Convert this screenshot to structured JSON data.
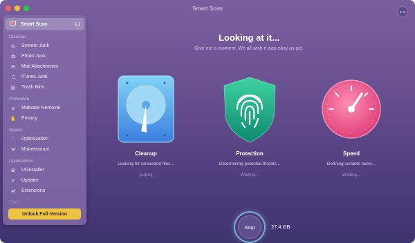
{
  "window": {
    "title": "Smart Scan"
  },
  "sidebar": {
    "active_item": {
      "label": "Smart Scan",
      "icon": "smart-scan-icon"
    },
    "sections": [
      {
        "title": "Cleanup",
        "items": [
          {
            "label": "System Junk",
            "icon": "system-junk-icon"
          },
          {
            "label": "Photo Junk",
            "icon": "photo-junk-icon"
          },
          {
            "label": "Mail Attachments",
            "icon": "mail-icon"
          },
          {
            "label": "iTunes Junk",
            "icon": "music-icon"
          },
          {
            "label": "Trash Bins",
            "icon": "trash-icon"
          }
        ]
      },
      {
        "title": "Protection",
        "items": [
          {
            "label": "Malware Removal",
            "icon": "biohazard-icon"
          },
          {
            "label": "Privacy",
            "icon": "hand-icon"
          }
        ]
      },
      {
        "title": "Speed",
        "items": [
          {
            "label": "Optimization",
            "icon": "sliders-icon"
          },
          {
            "label": "Maintenance",
            "icon": "wrench-icon"
          }
        ]
      },
      {
        "title": "Applications",
        "items": [
          {
            "label": "Uninstaller",
            "icon": "uninstaller-icon"
          },
          {
            "label": "Updater",
            "icon": "updater-icon"
          },
          {
            "label": "Extensions",
            "icon": "extensions-icon"
          }
        ]
      },
      {
        "title": "Files",
        "items": []
      }
    ],
    "unlock_label": "Unlock Full Version"
  },
  "main": {
    "heading": "Looking at it...",
    "subheading": "Give me a moment. We all wish it was easy as pie.",
    "modules": [
      {
        "title": "Cleanup",
        "description": "Looking for unneeded files...",
        "status": "ja.lproj",
        "icon": "hard-drive-icon"
      },
      {
        "title": "Protection",
        "description": "Determining potential threats...",
        "status": "Waiting...",
        "icon": "fingerprint-shield-icon"
      },
      {
        "title": "Speed",
        "description": "Defining suitable tasks...",
        "status": "Waiting...",
        "icon": "speedometer-icon"
      }
    ],
    "stop_label": "Stop",
    "scanned_size": "27.4 GB"
  },
  "colors": {
    "accent_yellow": "#ecc343",
    "background_top": "#7a5f9e",
    "background_bottom": "#3f3370"
  }
}
